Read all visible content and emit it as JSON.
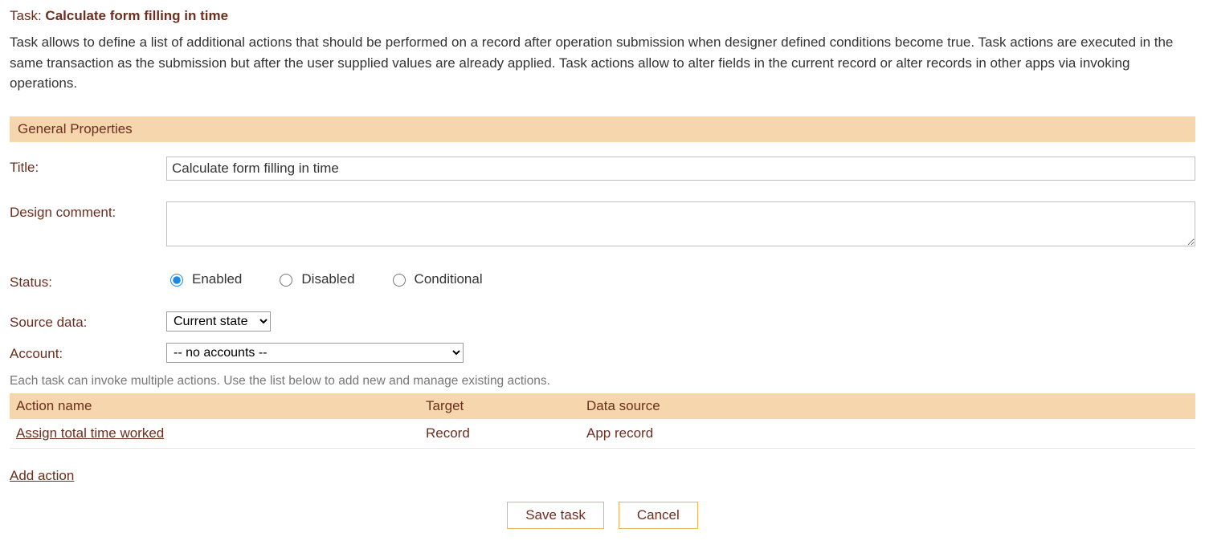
{
  "header": {
    "prefix": "Task:",
    "name": "Calculate form filling in time"
  },
  "description": "Task allows to define a list of additional actions that should be performed on a record after operation submission when designer defined conditions become true. Task actions are executed in the same transaction as the submission but after the user supplied values are already applied. Task actions allow to alter fields in the current record or alter records in other apps via invoking operations.",
  "section": {
    "general": "General Properties"
  },
  "labels": {
    "title": "Title:",
    "design_comment": "Design comment:",
    "status": "Status:",
    "source_data": "Source data:",
    "account": "Account:"
  },
  "fields": {
    "title_value": "Calculate form filling in time",
    "design_comment_value": "",
    "source_data_value": "Current state",
    "account_value": "-- no accounts --"
  },
  "status_options": {
    "enabled": "Enabled",
    "disabled": "Disabled",
    "conditional": "Conditional"
  },
  "helper": "Each task can invoke multiple actions. Use the list below to add new and manage existing actions.",
  "actions_table": {
    "columns": {
      "name": "Action name",
      "target": "Target",
      "source": "Data source"
    },
    "rows": [
      {
        "name": "Assign total time worked",
        "target": "Record",
        "source": "App record"
      }
    ]
  },
  "links": {
    "add_action": "Add action"
  },
  "buttons": {
    "save": "Save task",
    "cancel": "Cancel"
  }
}
